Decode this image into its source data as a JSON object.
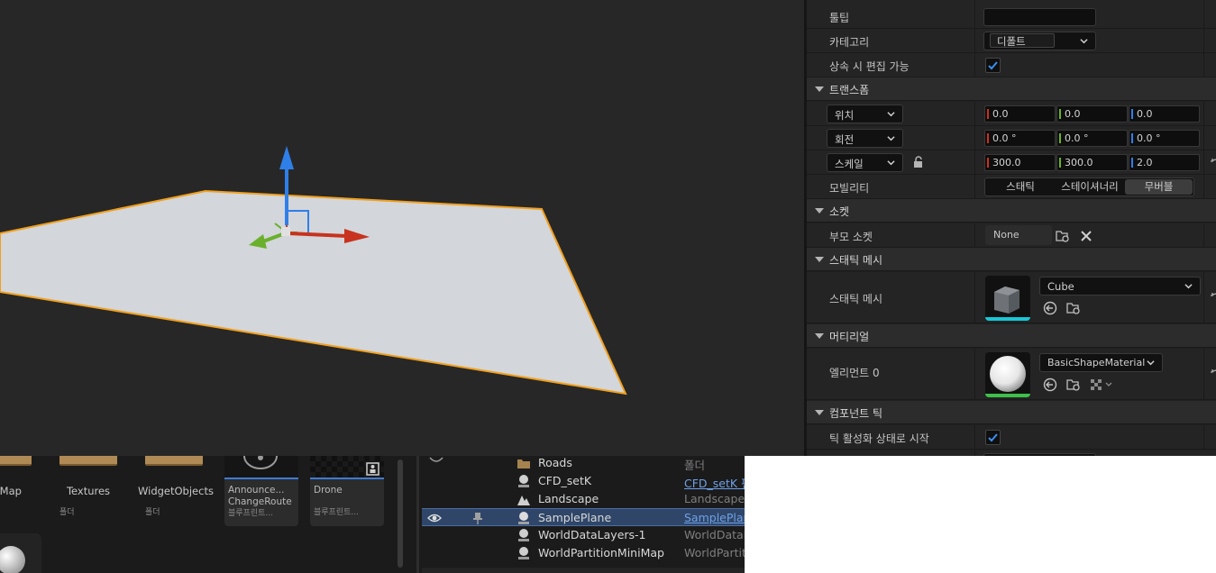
{
  "content_browser": {
    "folders": [
      {
        "name": "pleMap",
        "type": ""
      },
      {
        "name": "Textures",
        "type": "폴더"
      },
      {
        "name": "WidgetObjects",
        "type": "폴더"
      }
    ],
    "assets": [
      {
        "name_line1": "Announce...",
        "name_line2": "ChangeRoute",
        "type": "블루프린트..."
      },
      {
        "name_line1": "Drone",
        "name_line2": "",
        "type": "블루프린트..."
      }
    ]
  },
  "outliner": {
    "rows": [
      {
        "name": "Roads",
        "type": "폴더",
        "icon": "folder-icon",
        "type_link": false,
        "selected": false
      },
      {
        "name": "CFD_setK",
        "type": "CFD_setK 편",
        "icon": "actor-icon",
        "type_link": true,
        "selected": false
      },
      {
        "name": "Landscape",
        "type": "Landscape",
        "icon": "landscape-icon",
        "type_link": false,
        "selected": false
      },
      {
        "name": "SamplePlane",
        "type": "SamplePlan",
        "icon": "actor-icon",
        "type_link": true,
        "selected": true
      },
      {
        "name": "WorldDataLayers-1",
        "type": "WorldDataLa",
        "icon": "actor-icon",
        "type_link": false,
        "selected": false
      },
      {
        "name": "WorldPartitionMiniMap",
        "type": "WorldPartitio",
        "icon": "actor-icon",
        "type_link": false,
        "selected": false
      }
    ]
  },
  "details": {
    "tooltip": {
      "label": "툴팁",
      "value": ""
    },
    "category": {
      "label": "카테고리",
      "value": "디폴트"
    },
    "editable_on_inherit": {
      "label": "상속 시 편집 가능",
      "checked": true
    },
    "transform": {
      "header": "트랜스폼",
      "location": {
        "label": "위치",
        "x": "0.0",
        "y": "0.0",
        "z": "0.0"
      },
      "rotation": {
        "label": "회전",
        "x": "0.0 °",
        "y": "0.0 °",
        "z": "0.0 °"
      },
      "scale": {
        "label": "스케일",
        "x": "300.0",
        "y": "300.0",
        "z": "2.0"
      },
      "mobility": {
        "label": "모빌리티",
        "options": [
          "스태틱",
          "스테이셔너리",
          "무버블"
        ],
        "selected": "무버블"
      }
    },
    "socket": {
      "header": "소켓",
      "parent_socket": {
        "label": "부모 소켓",
        "value": "None"
      }
    },
    "static_mesh": {
      "header": "스태틱 메시",
      "label": "스태틱 메시",
      "value": "Cube"
    },
    "materials": {
      "header": "머티리얼",
      "label": "엘리먼트 0",
      "value": "BasicShapeMaterial"
    },
    "component_tick": {
      "header": "컴포넌트 틱",
      "start_enabled": {
        "label": "틱 활성화 상태로 시작",
        "checked": true
      }
    }
  },
  "colors": {
    "accent_blue": "#3d7ad6",
    "axis_x": "#c8321e",
    "axis_y": "#6ab02c",
    "axis_z": "#2f7fe8",
    "selection_outline": "#f0a020"
  }
}
